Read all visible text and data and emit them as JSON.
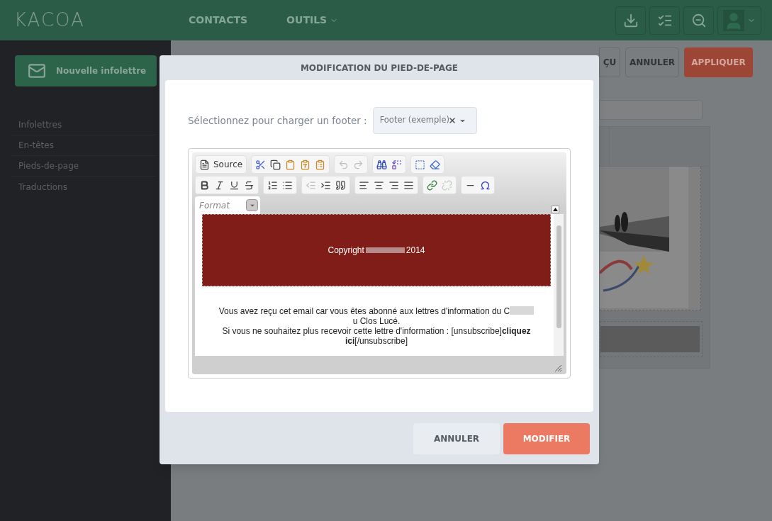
{
  "header": {
    "logo": "KACOA",
    "nav": [
      {
        "label": "CONTACTS",
        "dropdown": false
      },
      {
        "label": "OUTILS",
        "dropdown": true
      }
    ],
    "icons": [
      {
        "kind": "download"
      },
      {
        "kind": "checklist"
      },
      {
        "kind": "zoom-out"
      }
    ]
  },
  "sidebar": {
    "new_button": "Nouvelle infolettre",
    "items": [
      "Infolettres",
      "En-têtes",
      "Pieds-de-page",
      "Traductions"
    ]
  },
  "toolbar": {
    "buttons": [
      {
        "label": "ÇU",
        "kind": "outline"
      },
      {
        "label": "ANNULER",
        "kind": "outline"
      },
      {
        "label": "APPLIQUER",
        "kind": "primary"
      }
    ]
  },
  "modal": {
    "title": "MODIFICATION DU PIED-DE-PAGE",
    "select_label": "Sélectionnez pour charger un footer :",
    "select_value": "Footer (exemple)",
    "editor": {
      "toolbar_rows": [
        [
          [
            {
              "kind": "source",
              "label": "Source",
              "disabled": false
            }
          ],
          [
            {
              "kind": "cut",
              "disabled": false
            },
            {
              "kind": "copy",
              "disabled": false
            },
            {
              "kind": "paste",
              "disabled": false
            },
            {
              "kind": "paste-text",
              "disabled": false
            },
            {
              "kind": "paste-word",
              "disabled": false
            }
          ],
          [
            {
              "kind": "undo",
              "disabled": true
            },
            {
              "kind": "redo",
              "disabled": true
            }
          ],
          [
            {
              "kind": "find",
              "disabled": false
            },
            {
              "kind": "replace",
              "disabled": false
            }
          ],
          [
            {
              "kind": "select-all",
              "disabled": false
            },
            {
              "kind": "eraser",
              "disabled": false
            }
          ]
        ],
        [
          [
            {
              "kind": "bold",
              "disabled": false
            },
            {
              "kind": "italic",
              "disabled": false
            },
            {
              "kind": "underline",
              "disabled": false
            },
            {
              "kind": "strike",
              "disabled": false
            }
          ],
          [
            {
              "kind": "ol",
              "disabled": false
            },
            {
              "kind": "ul",
              "disabled": false
            }
          ],
          [
            {
              "kind": "outdent",
              "disabled": true
            },
            {
              "kind": "indent",
              "disabled": false
            },
            {
              "kind": "quote",
              "disabled": false
            }
          ],
          [
            {
              "kind": "align-left",
              "disabled": false
            },
            {
              "kind": "align-center",
              "disabled": false
            },
            {
              "kind": "align-right",
              "disabled": false
            },
            {
              "kind": "justify",
              "disabled": false
            }
          ],
          [
            {
              "kind": "link",
              "disabled": false
            },
            {
              "kind": "unlink",
              "disabled": true
            }
          ],
          [
            {
              "kind": "hr",
              "disabled": false
            },
            {
              "kind": "omega",
              "disabled": false
            }
          ]
        ]
      ],
      "format_placeholder": "Format",
      "banner_before": "Copyright",
      "banner_after": "2014",
      "notice_before": "Vous avez reçu cet email car vous êtes abonné aux lettres d'information du C",
      "notice_after": "u Clos Lucé.",
      "unsubscribe": "Si vous ne souhaitez plus recevoir cette lettre d'information : [unsubscribe]**cliquez ici**[/unsubscribe]"
    },
    "buttons": [
      {
        "label": "ANNULER",
        "kind": "secondary"
      },
      {
        "label": "MODIFIER",
        "kind": "primary"
      }
    ]
  }
}
